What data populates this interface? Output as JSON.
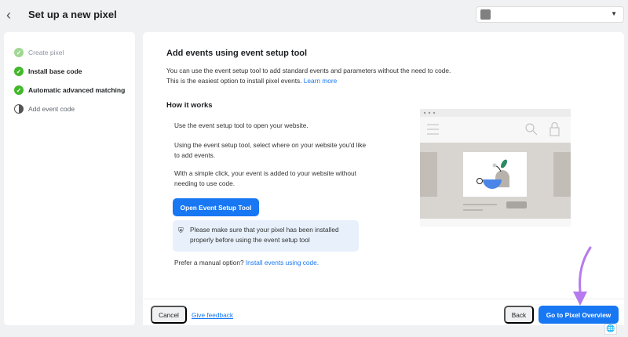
{
  "header": {
    "title": "Set up a new pixel",
    "back_icon": "chevron-left-icon",
    "account_color": "#808080"
  },
  "steps": [
    {
      "label": "Create pixel",
      "state": "done-faded"
    },
    {
      "label": "Install base code",
      "state": "done"
    },
    {
      "label": "Automatic advanced matching",
      "state": "done"
    },
    {
      "label": "Add event code",
      "state": "in-progress"
    }
  ],
  "main": {
    "title": "Add events using event setup tool",
    "intro": "You can use the event setup tool to add standard events and parameters without the need to code. This is the easiest option to install pixel events.",
    "learn_more": "Learn more",
    "how_title": "How it works",
    "how_items": [
      "Use the event setup tool to open your website.",
      "Using the event setup tool, select where on your website you'd like to add events.",
      "With a simple click, your event is added to your website without needing to use code."
    ],
    "open_tool": "Open Event Setup Tool",
    "note": "Please make sure that your pixel has been installed properly before using the event setup tool",
    "manual_prefix": "Prefer a manual option?",
    "manual_link": "Install events using code."
  },
  "footer": {
    "cancel": "Cancel",
    "feedback": "Give feedback",
    "back": "Back",
    "next": "Go to Pixel Overview"
  },
  "colors": {
    "primary": "#1877f2",
    "success": "#42b72a",
    "annotation": "#b57bee"
  }
}
